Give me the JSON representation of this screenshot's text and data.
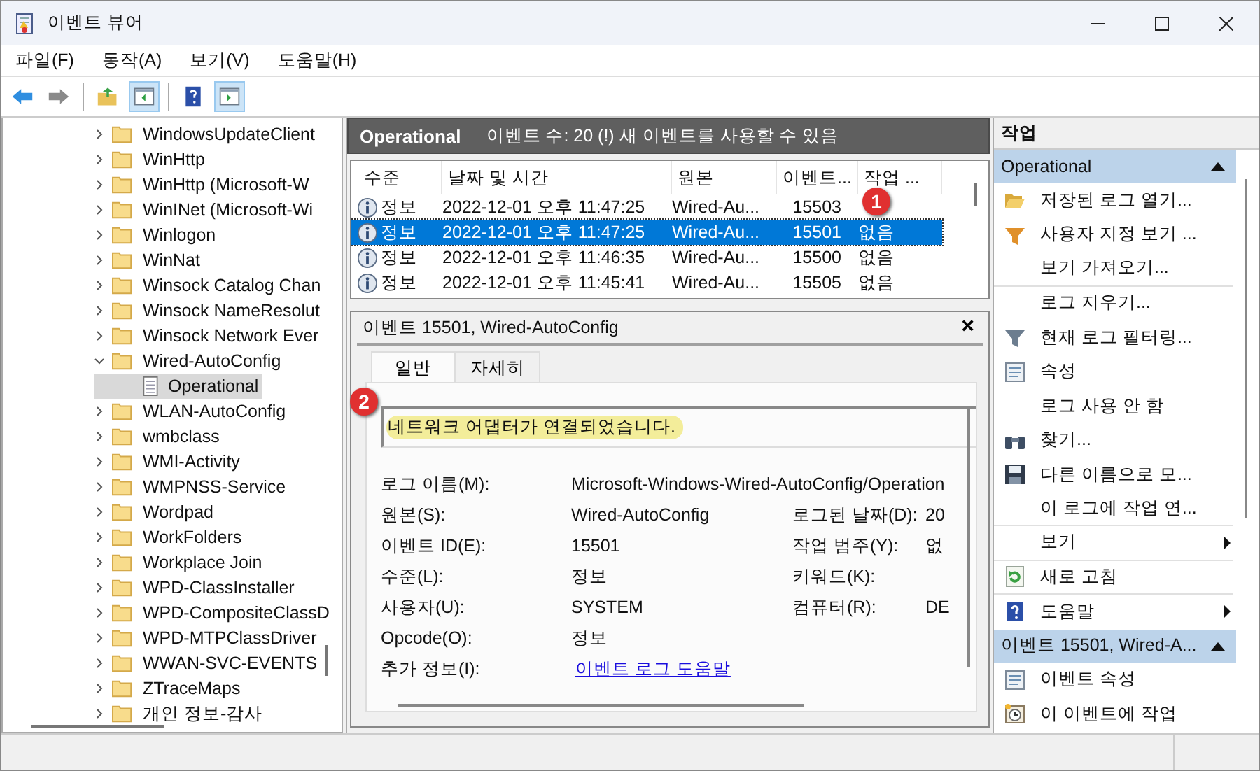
{
  "window": {
    "title": "이벤트 뷰어"
  },
  "menu": [
    "파일(F)",
    "동작(A)",
    "보기(V)",
    "도움말(H)"
  ],
  "toolbar": [
    {
      "kind": "back",
      "pressed": false
    },
    {
      "kind": "forward",
      "pressed": false
    },
    {
      "kind": "up",
      "pressed": false
    },
    {
      "kind": "tree",
      "pressed": true
    },
    {
      "kind": "help",
      "pressed": false
    },
    {
      "kind": "pane",
      "pressed": true
    }
  ],
  "tree": [
    {
      "label": "WindowsUpdateClient",
      "expanded": false,
      "selected": false
    },
    {
      "label": "WinHttp",
      "expanded": false,
      "selected": false
    },
    {
      "label": "WinHttp (Microsoft-W",
      "expanded": false,
      "selected": false
    },
    {
      "label": "WinINet (Microsoft-Wi",
      "expanded": false,
      "selected": false
    },
    {
      "label": "Winlogon",
      "expanded": false,
      "selected": false
    },
    {
      "label": "WinNat",
      "expanded": false,
      "selected": false
    },
    {
      "label": "Winsock Catalog Chan",
      "expanded": false,
      "selected": false
    },
    {
      "label": "Winsock NameResolut",
      "expanded": false,
      "selected": false
    },
    {
      "label": "Winsock Network Ever",
      "expanded": false,
      "selected": false
    },
    {
      "label": "Wired-AutoConfig",
      "expanded": true,
      "selected": false,
      "children": [
        {
          "label": "Operational",
          "selected": true
        }
      ]
    },
    {
      "label": "WLAN-AutoConfig",
      "expanded": false,
      "selected": false
    },
    {
      "label": "wmbclass",
      "expanded": false,
      "selected": false
    },
    {
      "label": "WMI-Activity",
      "expanded": false,
      "selected": false
    },
    {
      "label": "WMPNSS-Service",
      "expanded": false,
      "selected": false
    },
    {
      "label": "Wordpad",
      "expanded": false,
      "selected": false
    },
    {
      "label": "WorkFolders",
      "expanded": false,
      "selected": false
    },
    {
      "label": "Workplace Join",
      "expanded": false,
      "selected": false
    },
    {
      "label": "WPD-ClassInstaller",
      "expanded": false,
      "selected": false
    },
    {
      "label": "WPD-CompositeClassD",
      "expanded": false,
      "selected": false
    },
    {
      "label": "WPD-MTPClassDriver",
      "expanded": false,
      "selected": false
    },
    {
      "label": "WWAN-SVC-EVENTS",
      "expanded": false,
      "selected": false
    },
    {
      "label": "ZTraceMaps",
      "expanded": false,
      "selected": false
    },
    {
      "label": "개인 정보-감사",
      "expanded": false,
      "selected": false
    }
  ],
  "log_header": {
    "title": "Operational",
    "info": "이벤트 수: 20 (!) 새 이벤트를 사용할 수 있음"
  },
  "table": {
    "columns": [
      "수준",
      "날짜 및 시간",
      "원본",
      "이벤트...",
      "작업 ..."
    ],
    "rows": [
      {
        "cells": [
          "정보",
          "2022-12-01 오후 11:47:25",
          "Wired-Au...",
          "15503",
          ""
        ],
        "selected": false
      },
      {
        "cells": [
          "정보",
          "2022-12-01 오후 11:47:25",
          "Wired-Au...",
          "15501",
          "없음"
        ],
        "selected": true
      },
      {
        "cells": [
          "정보",
          "2022-12-01 오후 11:46:35",
          "Wired-Au...",
          "15500",
          "없음"
        ],
        "selected": false
      },
      {
        "cells": [
          "정보",
          "2022-12-01 오후 11:45:41",
          "Wired-Au...",
          "15505",
          "없음"
        ],
        "selected": false
      }
    ]
  },
  "detail": {
    "title": "이벤트 15501, Wired-AutoConfig",
    "close": "×",
    "tabs": [
      {
        "label": "일반",
        "selected": true
      },
      {
        "label": "자세히",
        "selected": false
      }
    ],
    "description": "네트워크 어댑터가 연결되었습니다.",
    "highlighted": true,
    "fields": [
      {
        "label": "로그 이름(M):",
        "value": "Microsoft-Windows-Wired-AutoConfig/Operation"
      },
      {
        "label": "원본(S):",
        "value": "Wired-AutoConfig",
        "label_2": "로그된 날짜(D):",
        "value_2": "20"
      },
      {
        "label": "이벤트 ID(E):",
        "value": "15501",
        "label_2": "작업 범주(Y):",
        "value_2": "없"
      },
      {
        "label": "수준(L):",
        "value": "정보",
        "label_2": "키워드(K):"
      },
      {
        "label": "사용자(U):",
        "value": "SYSTEM",
        "label_2": "컴퓨터(R):",
        "value_2": "DE"
      },
      {
        "label": "Opcode(O):",
        "value": "정보"
      },
      {
        "label": "추가 정보(I):",
        "link": "이벤트 로그 도움말"
      }
    ]
  },
  "callouts": [
    {
      "label": "1"
    },
    {
      "label": "2"
    }
  ],
  "actions": {
    "title": "작업",
    "sections": [
      {
        "title": "Operational",
        "expanded": true,
        "items": [
          {
            "label": "저장된 로그 열기...",
            "kind": "open"
          },
          {
            "label": "사용자 지정 보기 ...",
            "kind": "funnel-new"
          },
          {
            "label": "보기 가져오기...",
            "kind": "none",
            "divider_after": true
          },
          {
            "label": "로그 지우기...",
            "kind": "none"
          },
          {
            "label": "현재 로그 필터링...",
            "kind": "funnel"
          },
          {
            "label": "속성",
            "kind": "properties"
          },
          {
            "label": "로그 사용 안 함",
            "kind": "none"
          },
          {
            "label": "찾기...",
            "kind": "binoculars"
          },
          {
            "label": "다른 이름으로 모...",
            "kind": "save"
          },
          {
            "label": "이 로그에 작업 연...",
            "kind": "none",
            "divider_after": true
          },
          {
            "label": "보기",
            "kind": "none",
            "submenu": true,
            "divider_after": true
          },
          {
            "label": "새로 고침",
            "kind": "refresh",
            "divider_after": true
          },
          {
            "label": "도움말",
            "kind": "help",
            "submenu": true
          }
        ]
      },
      {
        "title": "이벤트 15501, Wired-A...",
        "expanded": true,
        "items": [
          {
            "label": "이벤트 속성",
            "kind": "properties"
          },
          {
            "label": "이 이벤트에 작업",
            "kind": "clock"
          }
        ]
      }
    ]
  }
}
